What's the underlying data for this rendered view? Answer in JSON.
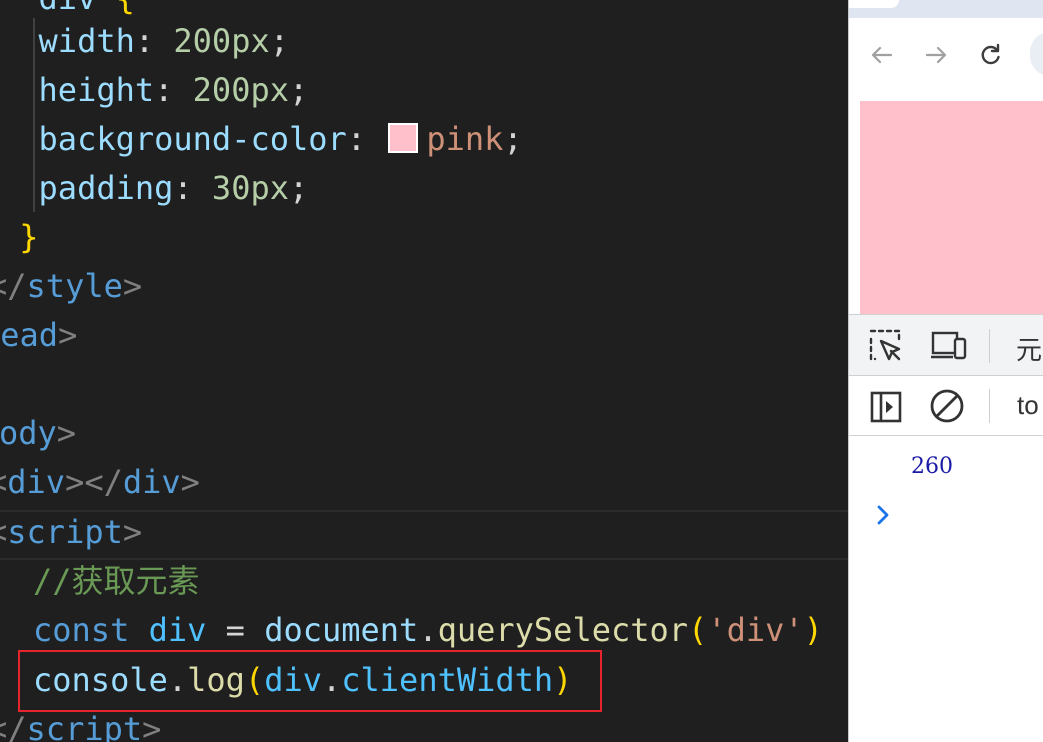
{
  "editor": {
    "lines": {
      "l0": {
        "tag": "div",
        "brace": "{"
      },
      "l1": {
        "prop": "width",
        "value": "200px"
      },
      "l2": {
        "prop": "height",
        "value": "200px"
      },
      "l3": {
        "prop": "background-color",
        "value": "pink"
      },
      "l4": {
        "prop": "padding",
        "value": "30px"
      },
      "l5": {
        "brace": "}"
      },
      "l6": {
        "tag": "style"
      },
      "l7": {
        "tag": "head"
      },
      "l8": {
        "tag": "ody"
      },
      "l9": {
        "open_tag": "div",
        "close_tag": "div"
      },
      "l10": {
        "tag": "script"
      },
      "l11": {
        "comment": "//获取元素"
      },
      "l12": {
        "keyword": "const",
        "var": "div",
        "op": "=",
        "obj": "document",
        "method": "querySelector",
        "arg": "'div'"
      },
      "l13": {
        "obj": "console",
        "method": "log",
        "var": "div",
        "prop": "clientWidth"
      },
      "l14": {
        "tag": "script"
      }
    },
    "swatch_color": "#ffc0cb",
    "highlight_color": "#e5242d"
  },
  "browser": {
    "devtools": {
      "first_tab_partial": "元",
      "filter_partial": "to"
    },
    "console": {
      "log_value": "260"
    },
    "page_div_color": "#ffc0cb"
  }
}
